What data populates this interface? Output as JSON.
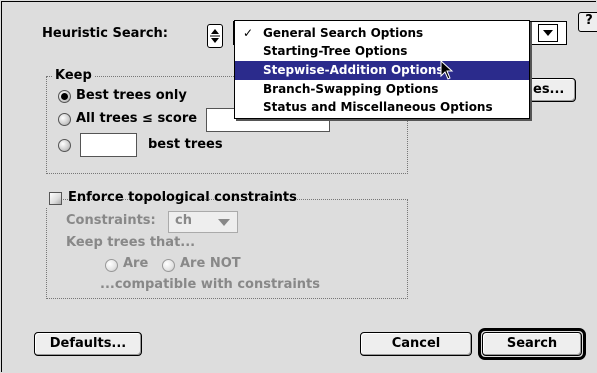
{
  "header": {
    "label": "Heuristic Search:",
    "help": "?"
  },
  "menu": {
    "items": [
      {
        "label": "General Search Options",
        "checked": true
      },
      {
        "label": "Starting-Tree Options",
        "checked": false
      },
      {
        "label": "Stepwise-Addition Options",
        "checked": false,
        "highlighted": true
      },
      {
        "label": "Branch-Swapping Options",
        "checked": false
      },
      {
        "label": "Status and Miscellaneous Options",
        "checked": false
      }
    ],
    "check_glyph": "✓",
    "highlight_color": "#2b2b8c"
  },
  "hidden_button_fragment": "es...",
  "keep": {
    "title": "Keep",
    "best_only": "Best trees only",
    "all_trees": "All trees ≤ score",
    "best_n": "best trees"
  },
  "constraints": {
    "enforce": "Enforce topological constraints",
    "constraints_label": "Constraints:",
    "constraints_value": "ch",
    "keep_trees": "Keep trees that...",
    "are": "Are",
    "are_not": "Are NOT",
    "compatible": "...compatible with constraints"
  },
  "buttons": {
    "defaults": "Defaults...",
    "cancel": "Cancel",
    "search": "Search"
  }
}
